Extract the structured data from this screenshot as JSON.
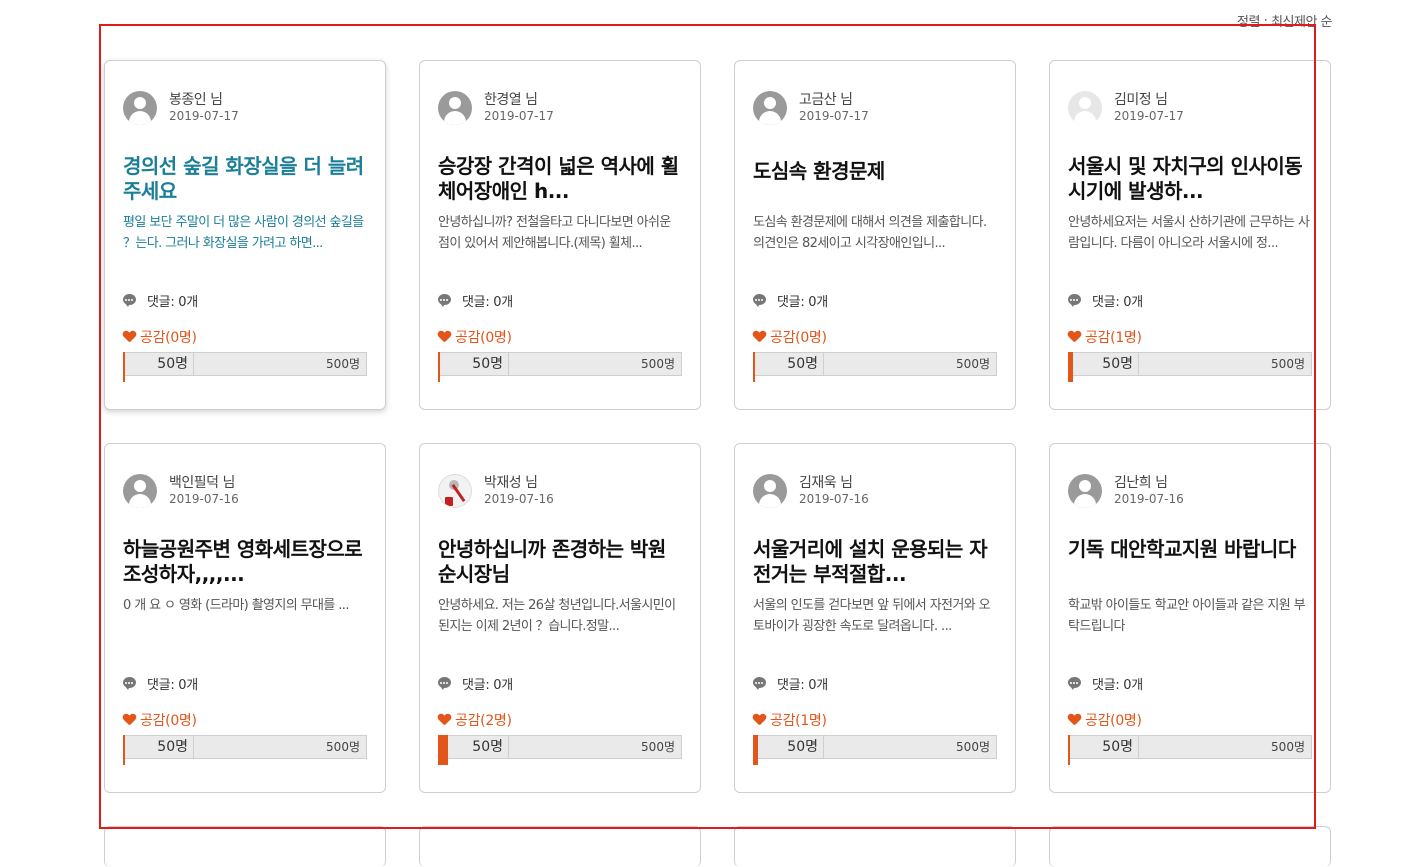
{
  "sort": {
    "label": "정렬 : 최신제안 순"
  },
  "cards": [
    {
      "author": "봉종인 님",
      "date": "2019-07-17",
      "title": "경의선 숲길 화장실을 더 늘려 주세요",
      "excerpt": "평일 보단 주말이 더 많은 사람이 경의선 숲길을 ？는다. 그러나 화장실을 가려고 하면...",
      "comments": "댓글: 0개",
      "likes": "공감(0명)",
      "current": "50명",
      "goal": "500명",
      "progress_ratio": 0.0
    },
    {
      "author": "한경열 님",
      "date": "2019-07-17",
      "title": "승강장 간격이 넓은 역사에 휠체어장애인 h...",
      "excerpt": "안녕하십니까? 전철을타고 다니다보면 아쉬운 점이 있어서 제안해봅니다.(제목) 휠체...",
      "comments": "댓글: 0개",
      "likes": "공감(0명)",
      "current": "50명",
      "goal": "500명",
      "progress_ratio": 0.0
    },
    {
      "author": "고금산 님",
      "date": "2019-07-17",
      "title": "도심속 환경문제",
      "excerpt": "도심속 환경문제에 대해서 의견을 제출합니다. 의견인은 82세이고 시각장애인입니...",
      "comments": "댓글: 0개",
      "likes": "공감(0명)",
      "current": "50명",
      "goal": "500명",
      "progress_ratio": 0.0
    },
    {
      "author": "김미정 님",
      "date": "2019-07-17",
      "title": "서울시 및 자치구의 인사이동 시기에 발생하...",
      "excerpt": "안녕하세요저는 서울시 산하기관에 근무하는 사람입니다. 다름이 아니오라 서울시에 정...",
      "comments": "댓글: 0개",
      "likes": "공감(1명)",
      "current": "50명",
      "goal": "500명",
      "progress_ratio": 0.02
    },
    {
      "author": "백인필덕 님",
      "date": "2019-07-16",
      "title": "하늘공원주변 영화세트장으로 조성하자,,,,...",
      "excerpt": "0 개 요 ㅇ 영화 (드라마) 촬영지의 무대를 ...",
      "comments": "댓글: 0개",
      "likes": "공감(0명)",
      "current": "50명",
      "goal": "500명",
      "progress_ratio": 0.0
    },
    {
      "author": "박재성 님",
      "date": "2019-07-16",
      "title": "안녕하십니까 존경하는 박원순시장님",
      "excerpt": "안녕하세요. 저는 26살 청년입니다.서울시민이 된지는 이제 2년이 ？습니다.정말...",
      "comments": "댓글: 0개",
      "likes": "공감(2명)",
      "current": "50명",
      "goal": "500명",
      "progress_ratio": 0.04
    },
    {
      "author": "김재욱 님",
      "date": "2019-07-16",
      "title": "서울거리에 설치 운용되는 자전거는 부적절합...",
      "excerpt": "서울의 인도를 걷다보면 앞 뒤에서 자전거와 오토바이가 굉장한 속도로 달려옵니다. ...",
      "comments": "댓글: 0개",
      "likes": "공감(1명)",
      "current": "50명",
      "goal": "500명",
      "progress_ratio": 0.02
    },
    {
      "author": "김난희 님",
      "date": "2019-07-16",
      "title": "기독 대안학교지원 바랍니다",
      "excerpt": "학교밖 아이들도 학교안 아이들과 같은 지원 부탁드립니다",
      "comments": "댓글: 0개",
      "likes": "공감(0명)",
      "current": "50명",
      "goal": "500명",
      "progress_ratio": 0.0
    }
  ],
  "colors": {
    "accent": "#e2561b",
    "active_title": "#1a7f98",
    "frame": "#e01b1b"
  }
}
